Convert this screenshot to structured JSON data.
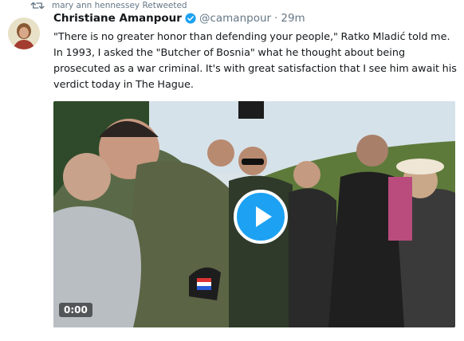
{
  "retweet": {
    "icon": "retweet-icon",
    "text": "mary ann hennessey Retweeted"
  },
  "tweet": {
    "display_name": "Christiane Amanpour",
    "verified_icon": "verified-badge-icon",
    "handle": "@camanpour",
    "separator": "·",
    "time": "29m",
    "text": "\"There is no greater honor than defending your people,\" Ratko Mladić told me. In 1993, I asked the \"Butcher of Bosnia\" what he thought about being prosecuted as a war criminal. It's with great satisfaction that I see him await his verdict today in The Hague."
  },
  "video": {
    "play_icon": "play-icon",
    "timestamp": "0:00"
  },
  "colors": {
    "accent": "#1da1f2",
    "secondary_text": "#657786",
    "primary_text": "#14171a"
  }
}
